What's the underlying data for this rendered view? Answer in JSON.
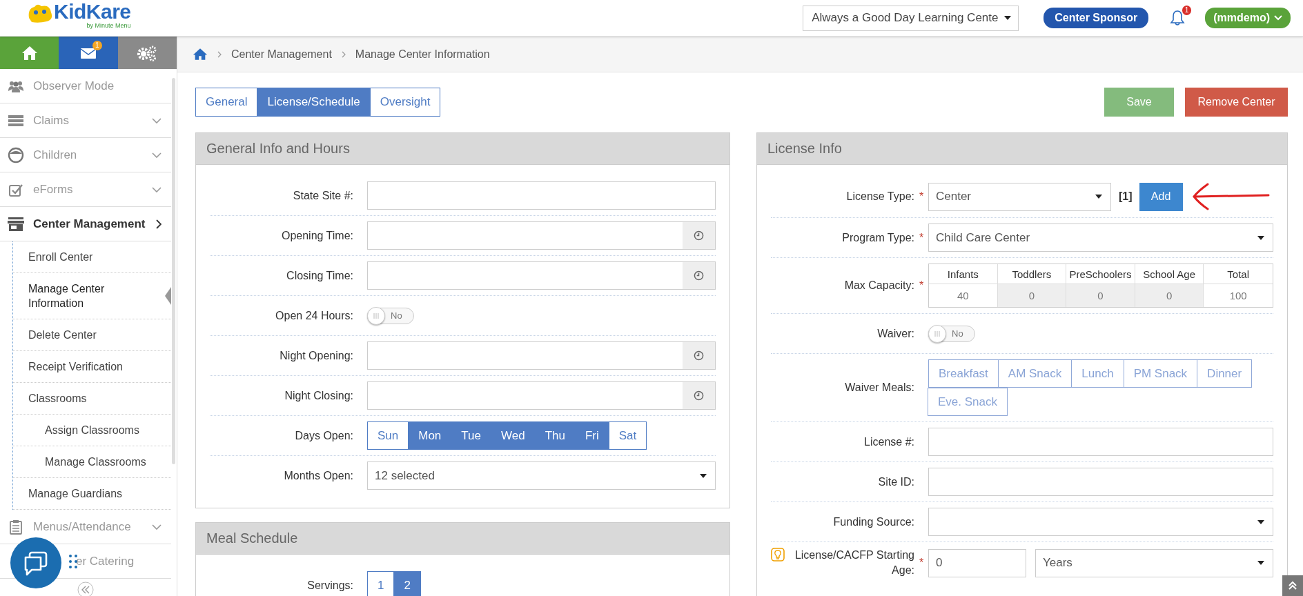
{
  "header": {
    "logo": "KidKare",
    "logo_sub": "by Minute Menu",
    "center_select": "Always a Good Day Learning Cente",
    "sponsor_button": "Center Sponsor",
    "notification_count": "1",
    "user_menu": "(mmdemo)"
  },
  "nav_tiles": [
    {
      "kind": "home"
    },
    {
      "kind": "mail",
      "badge": "1"
    },
    {
      "kind": "settings"
    }
  ],
  "sidebar": {
    "items": [
      {
        "kind": "users",
        "label": "Observer Mode",
        "expandable": false,
        "expanded": false
      },
      {
        "kind": "claims",
        "label": "Claims",
        "expandable": true,
        "expanded": false
      },
      {
        "kind": "child",
        "label": "Children",
        "expandable": true,
        "expanded": false
      },
      {
        "kind": "check",
        "label": "eForms",
        "expandable": true,
        "expanded": false
      },
      {
        "kind": "store",
        "label": "Center Management",
        "expandable": true,
        "expanded": true,
        "children": [
          {
            "label": "Enroll Center",
            "selected": false
          },
          {
            "label": "Manage Center Information",
            "selected": true
          },
          {
            "label": "Delete Center",
            "selected": false
          },
          {
            "label": "Receipt Verification",
            "selected": false
          },
          {
            "label": "Classrooms",
            "selected": false,
            "children": [
              {
                "label": "Assign Classrooms",
                "selected": false
              },
              {
                "label": "Manage Classrooms",
                "selected": false
              }
            ]
          },
          {
            "label": "Manage Guardians",
            "selected": false
          }
        ]
      },
      {
        "kind": "clipboard",
        "label": "Menus/Attendance",
        "expandable": true,
        "expanded": false
      },
      {
        "kind": "covered",
        "label": "er Catering",
        "expandable": false,
        "expanded": false
      }
    ]
  },
  "breadcrumb": [
    "Center Management",
    "Manage Center Information"
  ],
  "tabs": [
    {
      "label": "General",
      "selected": false
    },
    {
      "label": "License/Schedule",
      "selected": true
    },
    {
      "label": "Oversight",
      "selected": false
    }
  ],
  "actions": [
    {
      "kind": "save",
      "label": "Save"
    },
    {
      "kind": "remove",
      "label": "Remove Center"
    }
  ],
  "general_panel": {
    "title": "General Info and Hours",
    "rows": [
      {
        "kind": "text",
        "label": "State Site #:"
      },
      {
        "kind": "time",
        "label": "Opening Time:"
      },
      {
        "kind": "time",
        "label": "Closing Time:"
      },
      {
        "kind": "toggle",
        "label": "Open 24 Hours:",
        "on": false,
        "state_text": "No"
      },
      {
        "kind": "time",
        "label": "Night Opening:"
      },
      {
        "kind": "time",
        "label": "Night Closing:"
      },
      {
        "kind": "options",
        "label": "Days Open:",
        "disabled": false,
        "options": [
          {
            "label": "Sun",
            "selected": false
          },
          {
            "label": "Mon",
            "selected": true
          },
          {
            "label": "Tue",
            "selected": true
          },
          {
            "label": "Wed",
            "selected": true
          },
          {
            "label": "Thu",
            "selected": true
          },
          {
            "label": "Fri",
            "selected": true
          },
          {
            "label": "Sat",
            "selected": false
          }
        ]
      },
      {
        "kind": "select",
        "label": "Months Open:",
        "value": "12 selected"
      }
    ]
  },
  "meal_panel": {
    "title": "Meal Schedule",
    "rows": [
      {
        "kind": "options",
        "label": "Servings:",
        "disabled": false,
        "options": [
          {
            "label": "1",
            "selected": false
          },
          {
            "label": "2",
            "selected": true
          }
        ]
      }
    ]
  },
  "license_panel": {
    "title": "License Info",
    "rows": [
      {
        "kind": "license_type",
        "label": "License Type:",
        "marker": "*",
        "value": "Center",
        "count": "[1]",
        "button": "Add",
        "pointer_arrow": true
      },
      {
        "kind": "select",
        "label": "Program Type:",
        "marker": "*",
        "value": "Child Care Center"
      },
      {
        "kind": "capacity",
        "label": "Max Capacity:",
        "marker": "*",
        "columns": [
          "Infants",
          "Toddlers",
          "PreSchoolers",
          "School Age",
          "Total"
        ],
        "values": [
          {
            "value": "40",
            "disabled": false
          },
          {
            "value": "0",
            "disabled": true
          },
          {
            "value": "0",
            "disabled": true
          },
          {
            "value": "0",
            "disabled": true
          },
          {
            "value": "100",
            "disabled": false
          }
        ]
      },
      {
        "kind": "toggle",
        "label": "Waiver:",
        "on": false,
        "state_text": "No"
      },
      {
        "kind": "options",
        "label": "Waiver Meals:",
        "disabled": true,
        "options": [
          {
            "label": "Breakfast",
            "selected": false
          },
          {
            "label": "AM Snack",
            "selected": false
          },
          {
            "label": "Lunch",
            "selected": false
          },
          {
            "label": "PM Snack",
            "selected": false
          },
          {
            "label": "Dinner",
            "selected": false
          },
          {
            "label": "Eve. Snack",
            "selected": false
          }
        ]
      },
      {
        "kind": "text",
        "label": "License #:"
      },
      {
        "kind": "text",
        "label": "Site ID:"
      },
      {
        "kind": "select",
        "label": "Funding Source:"
      },
      {
        "kind": "age",
        "label": "License/CACFP Starting Age:",
        "marker": "*",
        "hint": true,
        "value": "0",
        "unit": "Years"
      }
    ]
  }
}
